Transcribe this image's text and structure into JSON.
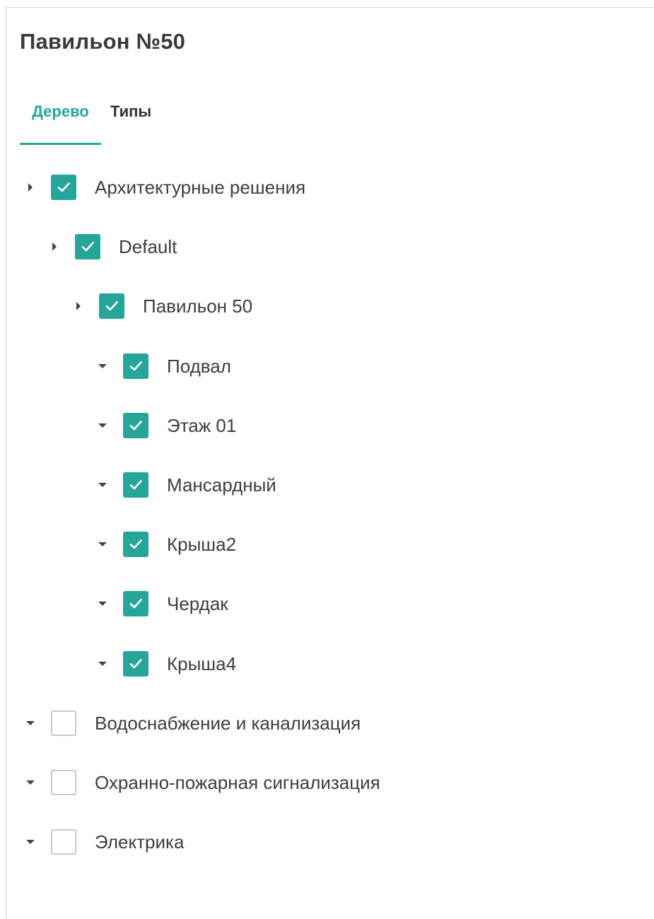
{
  "panel": {
    "title": "Павильон №50"
  },
  "tabs": [
    {
      "label": "Дерево",
      "active": true
    },
    {
      "label": "Типы",
      "active": false
    }
  ],
  "colors": {
    "accent": "#26a69a",
    "checkbox_border": "#c8c8c8",
    "text": "#3d3d3d"
  },
  "tree": [
    {
      "label": "Архитектурные решения",
      "level": 0,
      "arrow": "right",
      "checked": true
    },
    {
      "label": "Default",
      "level": 1,
      "arrow": "right",
      "checked": true
    },
    {
      "label": "Павильон 50",
      "level": 2,
      "arrow": "right",
      "checked": true
    },
    {
      "label": "Подвал",
      "level": 3,
      "arrow": "down",
      "checked": true
    },
    {
      "label": "Этаж 01",
      "level": 3,
      "arrow": "down",
      "checked": true
    },
    {
      "label": "Мансардный",
      "level": 3,
      "arrow": "down",
      "checked": true
    },
    {
      "label": "Крыша2",
      "level": 3,
      "arrow": "down",
      "checked": true
    },
    {
      "label": "Чердак",
      "level": 3,
      "arrow": "down",
      "checked": true
    },
    {
      "label": "Крыша4",
      "level": 3,
      "arrow": "down",
      "checked": true
    },
    {
      "label": "Водоснабжение и канализация",
      "level": 0,
      "arrow": "down",
      "checked": false
    },
    {
      "label": "Охранно-пожарная сигнализация",
      "level": 0,
      "arrow": "down",
      "checked": false
    },
    {
      "label": "Электрика",
      "level": 0,
      "arrow": "down",
      "checked": false
    }
  ]
}
